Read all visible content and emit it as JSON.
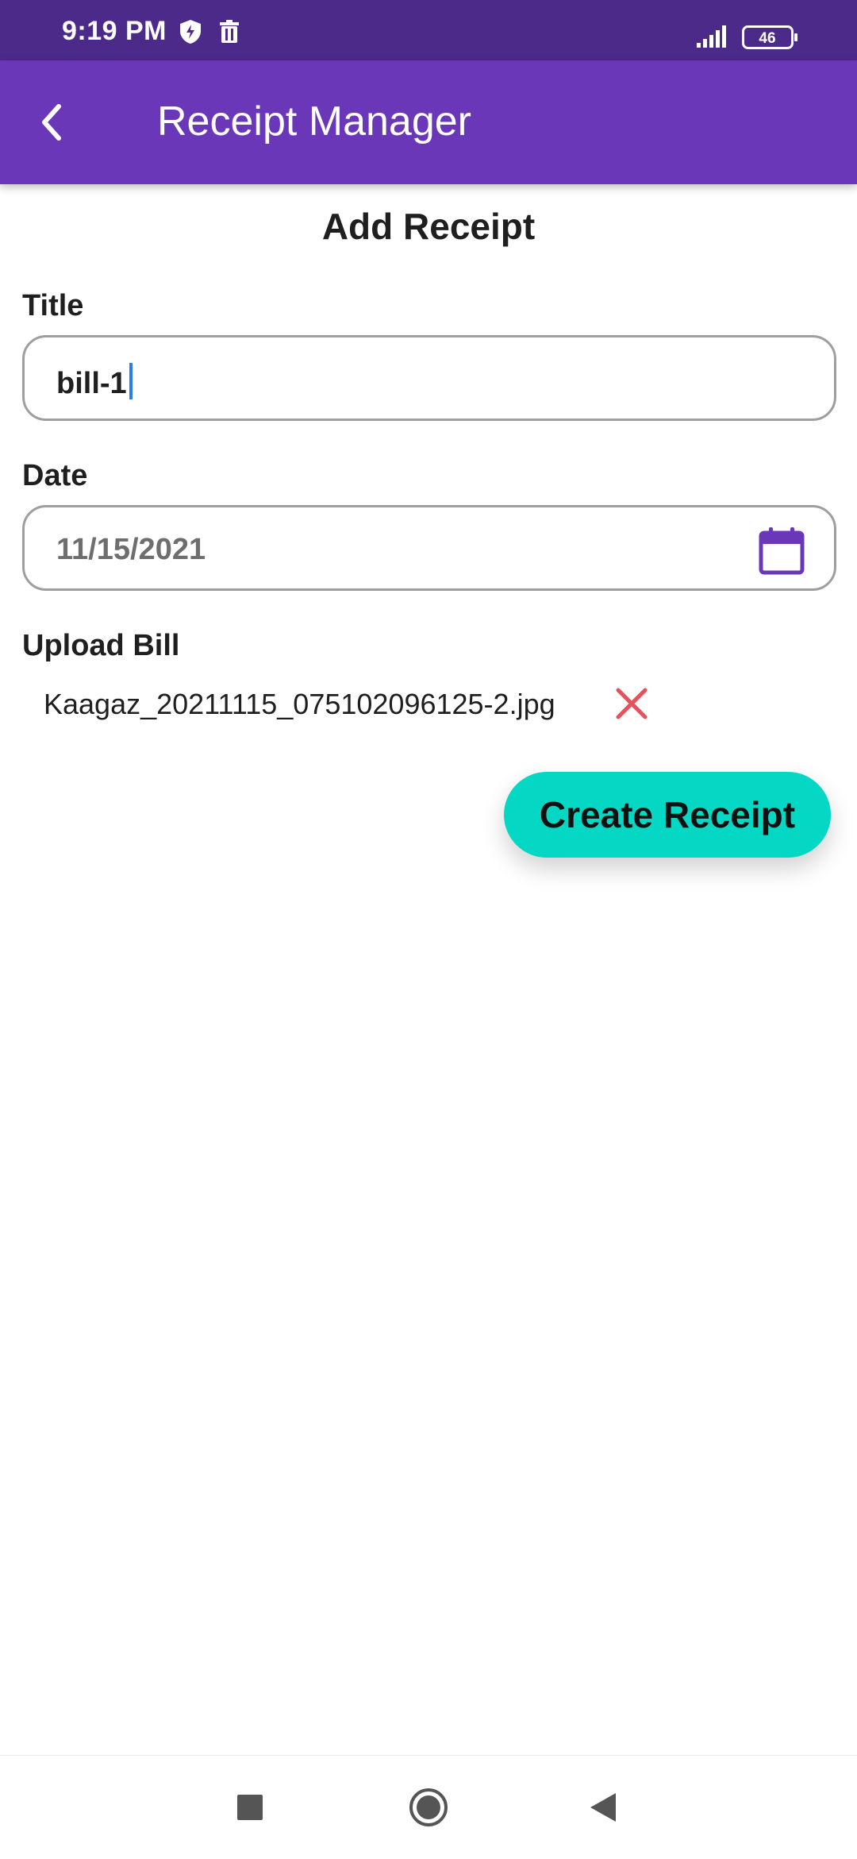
{
  "status_bar": {
    "time": "9:19 PM",
    "battery": "46",
    "icons": [
      "shield-bolt-icon",
      "trash-icon",
      "signal-icon",
      "battery-icon"
    ]
  },
  "app_bar": {
    "title": "Receipt Manager",
    "back_icon": "chevron-left-icon"
  },
  "form": {
    "heading": "Add Receipt",
    "title_label": "Title",
    "title_value": "bill-1",
    "date_label": "Date",
    "date_value": "11/15/2021",
    "calendar_icon": "calendar-icon",
    "upload_label": "Upload Bill",
    "file_name": "Kaagaz_20211115_075102096125-2.jpg",
    "remove_icon": "close-icon",
    "submit_label": "Create Receipt"
  },
  "nav_bar": {
    "icons": [
      "recents-square-icon",
      "home-circle-icon",
      "back-triangle-icon"
    ]
  },
  "colors": {
    "status_bar": "#4c2a8a",
    "app_bar": "#6937b8",
    "accent_purple": "#6937b8",
    "button": "#04d8c5",
    "remove": "#e8505b",
    "cursor": "#2b7de9"
  }
}
